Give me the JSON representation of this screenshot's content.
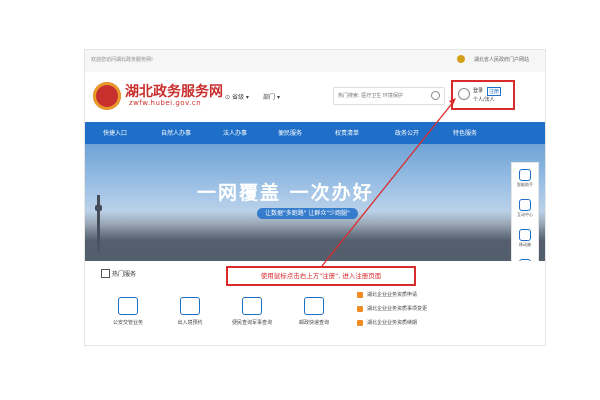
{
  "topbar": {
    "welcome": "欢迎您访问湖北政务服务网!",
    "gov_portal": "湖北省人民政府门户网站"
  },
  "header": {
    "site_name": "湖北政务服务网",
    "site_url": "zwfw.hubei.gov.cn",
    "region": "省级",
    "department": "部门",
    "search_placeholder": "热门搜索: 医疗卫生 环境保护",
    "login": "登录",
    "register": "注册",
    "legal_person": "个人/法人"
  },
  "nav": {
    "items": [
      "快捷入口",
      "自然人办事",
      "法人办事",
      "便民服务",
      "权责清单",
      "政务公开",
      "特色服务"
    ]
  },
  "banner": {
    "slogan": "一网覆盖  一次办好",
    "subtitle": "让数据\"多跑路\"  让群众\"少跑腿\""
  },
  "sidefloat": {
    "items": [
      "智能助手",
      "互动中心",
      "移动端",
      "微信端"
    ],
    "collapse": "收起"
  },
  "services": {
    "title": "热门服务",
    "items": [
      "公安交管业务",
      "出入境预约",
      "便民查询军事查询",
      "邮政快递查询"
    ],
    "list": [
      "湖北企业业务资质申请",
      "湖北企业业务资质事项变更",
      "湖北企业业务资质续期"
    ]
  },
  "annotation": {
    "callout": "使用鼠标点击右上方\"注册\", 进入注册页面"
  },
  "colors": {
    "brand_red": "#c8302e",
    "nav_blue": "#1f6fc9",
    "annotation_red": "#d92b2b"
  }
}
